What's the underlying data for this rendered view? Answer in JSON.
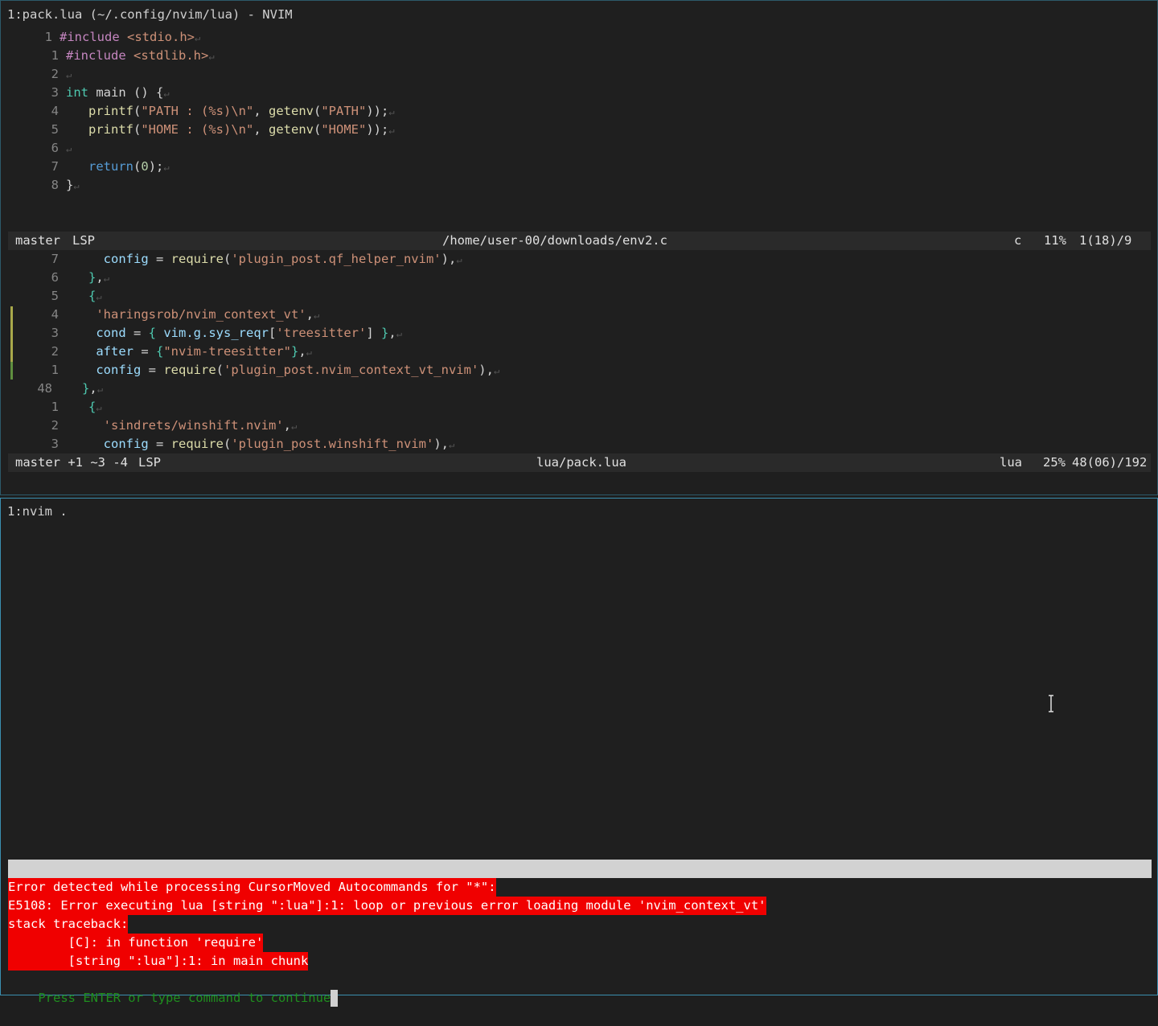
{
  "top_window": {
    "title": "1:pack.lua (~/.config/nvim/lua) - NVIM",
    "c_buffer": {
      "lines": [
        {
          "num": "1",
          "tokens": [
            [
              "kw-pp",
              "#include"
            ],
            [
              "",
              " "
            ],
            [
              "str",
              "<stdio.h>"
            ]
          ]
        },
        {
          "num": "1",
          "tokens": [
            [
              "kw-pp",
              "#include"
            ],
            [
              "",
              " "
            ],
            [
              "str",
              "<stdlib.h>"
            ]
          ]
        },
        {
          "num": "2",
          "tokens": []
        },
        {
          "num": "3",
          "tokens": [
            [
              "type",
              "int"
            ],
            [
              "",
              " main () {"
            ]
          ]
        },
        {
          "num": "4",
          "tokens": [
            [
              "",
              "   "
            ],
            [
              "fn",
              "printf"
            ],
            [
              "",
              "("
            ],
            [
              "str",
              "\"PATH : (%s)\\n\""
            ],
            [
              "",
              ", "
            ],
            [
              "fn",
              "getenv"
            ],
            [
              "",
              "("
            ],
            [
              "str",
              "\"PATH\""
            ],
            [
              "",
              "));"
            ]
          ]
        },
        {
          "num": "5",
          "tokens": [
            [
              "",
              "   "
            ],
            [
              "fn",
              "printf"
            ],
            [
              "",
              "("
            ],
            [
              "str",
              "\"HOME : (%s)\\n\""
            ],
            [
              "",
              ", "
            ],
            [
              "fn",
              "getenv"
            ],
            [
              "",
              "("
            ],
            [
              "str",
              "\"HOME\""
            ],
            [
              "",
              "));"
            ]
          ]
        },
        {
          "num": "6",
          "tokens": []
        },
        {
          "num": "7",
          "tokens": [
            [
              "",
              "   "
            ],
            [
              "kw",
              "return"
            ],
            [
              "",
              "("
            ],
            [
              "num",
              "0"
            ],
            [
              "",
              ");"
            ]
          ]
        },
        {
          "num": "8",
          "tokens": [
            [
              "",
              "}"
            ]
          ]
        }
      ],
      "status": {
        "branch": "master",
        "lsp": "LSP",
        "file": "/home/user-00/downloads/env2.c",
        "filetype": "c",
        "percent": "11%",
        "position": "1(18)/9"
      }
    },
    "lua_buffer": {
      "lines": [
        {
          "num": "7",
          "tokens": [
            [
              "",
              "     "
            ],
            [
              "var",
              "config"
            ],
            [
              "",
              " = "
            ],
            [
              "fn",
              "require"
            ],
            [
              "",
              "("
            ],
            [
              "str",
              "'plugin_post.qf_helper_nvim'"
            ],
            [
              "",
              "),"
            ]
          ]
        },
        {
          "num": "6",
          "tokens": [
            [
              "",
              "   "
            ],
            [
              "brace",
              "}"
            ],
            [
              "",
              ","
            ]
          ]
        },
        {
          "num": "5",
          "tokens": [
            [
              "",
              "   "
            ],
            [
              "brace",
              "{"
            ]
          ]
        },
        {
          "num": "4",
          "tokens": [
            [
              "",
              "    "
            ],
            [
              "str",
              "'haringsrob/nvim_context_vt'"
            ],
            [
              "",
              ","
            ]
          ]
        },
        {
          "num": "3",
          "tokens": [
            [
              "",
              "    "
            ],
            [
              "var",
              "cond"
            ],
            [
              "",
              " = "
            ],
            [
              "brace",
              "{"
            ],
            [
              "",
              " "
            ],
            [
              "var",
              "vim.g.sys_reqr"
            ],
            [
              "",
              "["
            ],
            [
              "str",
              "'treesitter'"
            ],
            [
              "",
              "] "
            ],
            [
              "brace",
              "}"
            ],
            [
              "",
              ","
            ]
          ]
        },
        {
          "num": "2",
          "tokens": [
            [
              "",
              "    "
            ],
            [
              "var",
              "after"
            ],
            [
              "",
              " = "
            ],
            [
              "brace",
              "{"
            ],
            [
              "str",
              "\"nvim-treesitter\""
            ],
            [
              "brace",
              "}"
            ],
            [
              "",
              ","
            ]
          ]
        },
        {
          "num": "1",
          "tokens": [
            [
              "",
              "    "
            ],
            [
              "var",
              "config"
            ],
            [
              "",
              " = "
            ],
            [
              "fn",
              "require"
            ],
            [
              "",
              "("
            ],
            [
              "str",
              "'plugin_post.nvim_context_vt_nvim'"
            ],
            [
              "",
              "),"
            ]
          ]
        },
        {
          "num": "48",
          "tokens": [
            [
              "",
              "   "
            ],
            [
              "brace",
              "}"
            ],
            [
              "",
              ","
            ]
          ]
        },
        {
          "num": "1",
          "tokens": [
            [
              "",
              "   "
            ],
            [
              "brace",
              "{"
            ]
          ]
        },
        {
          "num": "2",
          "tokens": [
            [
              "",
              "     "
            ],
            [
              "str",
              "'sindrets/winshift.nvim'"
            ],
            [
              "",
              ","
            ]
          ]
        },
        {
          "num": "3",
          "tokens": [
            [
              "",
              "     "
            ],
            [
              "var",
              "config"
            ],
            [
              "",
              " = "
            ],
            [
              "fn",
              "require"
            ],
            [
              "",
              "("
            ],
            [
              "str",
              "'plugin_post.winshift_nvim'"
            ],
            [
              "",
              "),"
            ]
          ]
        }
      ],
      "status": {
        "branch": "master +1 ~3 -4",
        "lsp": "LSP",
        "file": "lua/pack.lua",
        "filetype": "lua",
        "percent": "25%",
        "position": "48(06)/192"
      }
    }
  },
  "bottom_window": {
    "title": "1:nvim .",
    "errors": [
      "Error detected while processing CursorMoved Autocommands for \"*\":",
      "E5108: Error executing lua [string \":lua\"]:1: loop or previous error loading module 'nvim_context_vt'",
      "stack traceback:",
      "        [C]: in function 'require'",
      "        [string \":lua\"]:1: in main chunk"
    ],
    "prompt": "Press ENTER or type command to continue"
  },
  "colors": {
    "error_bg": "#f00000",
    "prompt_fg": "#1f8f1f",
    "string": "#ce9178",
    "keyword": "#569cd6",
    "function": "#dcdcaa",
    "preproc": "#c586c0"
  }
}
